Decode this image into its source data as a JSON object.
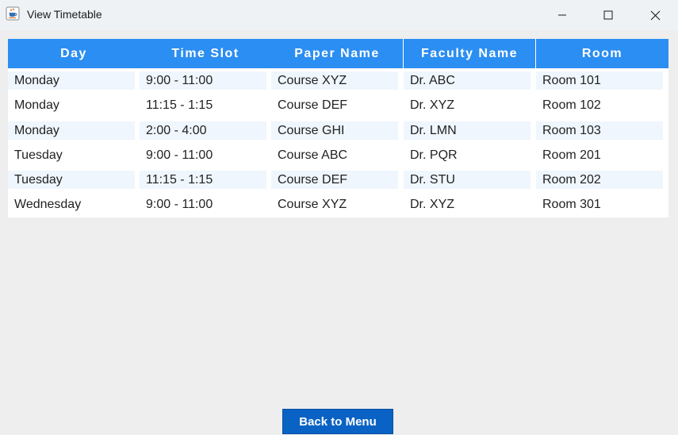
{
  "window": {
    "title": "View Timetable"
  },
  "colors": {
    "header_bg": "#2b8ef2",
    "header_text": "#ffffff",
    "row_shade": "#eff6fd",
    "button_bg": "#0a62c4"
  },
  "table": {
    "columns": [
      "Day",
      "Time Slot",
      "Paper Name",
      "Faculty Name",
      "Room"
    ],
    "rows": [
      [
        "Monday",
        "9:00 - 11:00",
        "Course XYZ",
        "Dr. ABC",
        "Room 101"
      ],
      [
        "Monday",
        "11:15 - 1:15",
        "Course DEF",
        "Dr. XYZ",
        "Room 102"
      ],
      [
        "Monday",
        "2:00 - 4:00",
        "Course GHI",
        "Dr. LMN",
        "Room 103"
      ],
      [
        "Tuesday",
        "9:00 - 11:00",
        "Course ABC",
        "Dr. PQR",
        "Room 201"
      ],
      [
        "Tuesday",
        "11:15 - 1:15",
        "Course DEF",
        "Dr. STU",
        "Room 202"
      ],
      [
        "Wednesday",
        "9:00 - 11:00",
        "Course XYZ",
        "Dr. XYZ",
        "Room 301"
      ]
    ]
  },
  "footer": {
    "back_label": "Back to Menu"
  }
}
